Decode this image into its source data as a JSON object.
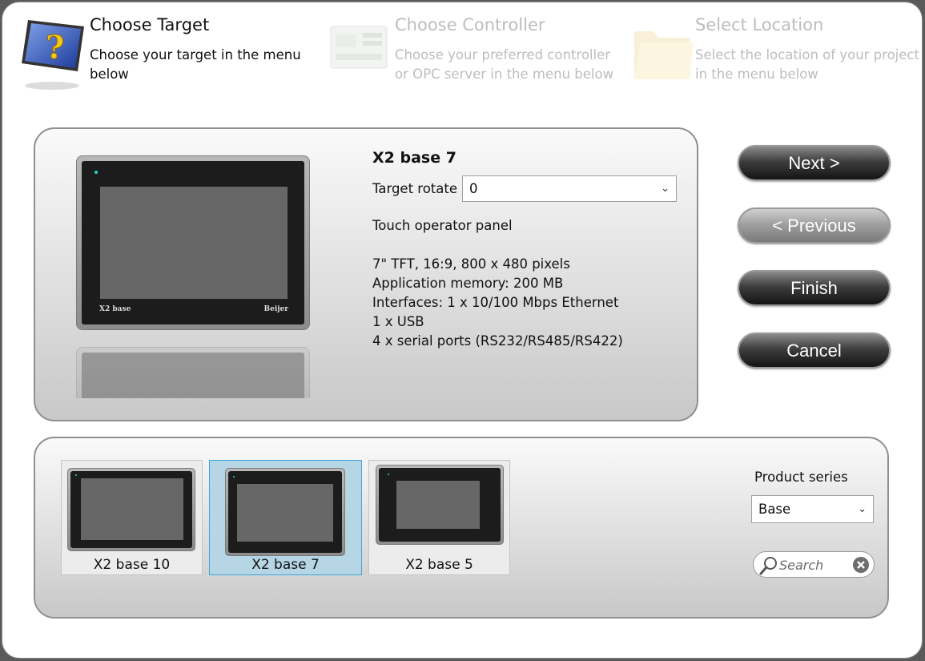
{
  "steps": [
    {
      "title": "Choose Target",
      "desc1": "Choose your target in the menu",
      "desc2": "below",
      "icon": "question-monitor-icon"
    },
    {
      "title": "Choose Controller",
      "desc1": "Choose your preferred controller",
      "desc2": "or OPC server in the menu below",
      "icon": "plc-controller-icon"
    },
    {
      "title": "Select Location",
      "desc1": "Select the location of your project",
      "desc2": "in the menu below",
      "icon": "folder-icon"
    }
  ],
  "target": {
    "name": "X2 base 7",
    "rotate_label": "Target rotate",
    "rotate_value": "0",
    "type": "Touch operator panel",
    "specs": [
      "7\" TFT, 16:9, 800 x 480 pixels",
      "Application memory: 200 MB",
      "Interfaces: 1 x 10/100 Mbps Ethernet",
      "1 x USB",
      "4 x serial ports (RS232/RS485/RS422)"
    ],
    "brand_model": "X2 base",
    "brand_maker": "Beijer"
  },
  "buttons": {
    "next": "Next >",
    "previous": "< Previous",
    "finish": "Finish",
    "cancel": "Cancel"
  },
  "targets": [
    {
      "label": "X2 base 10",
      "selected": false
    },
    {
      "label": "X2 base 7",
      "selected": true
    },
    {
      "label": "X2 base 5",
      "selected": false
    }
  ],
  "filter": {
    "series_label": "Product series",
    "series_value": "Base",
    "search_placeholder": "Search"
  },
  "colors": {
    "selected_tile": "#b6d6e6",
    "selected_border": "#3ea6da",
    "led": "#29d6c8"
  }
}
